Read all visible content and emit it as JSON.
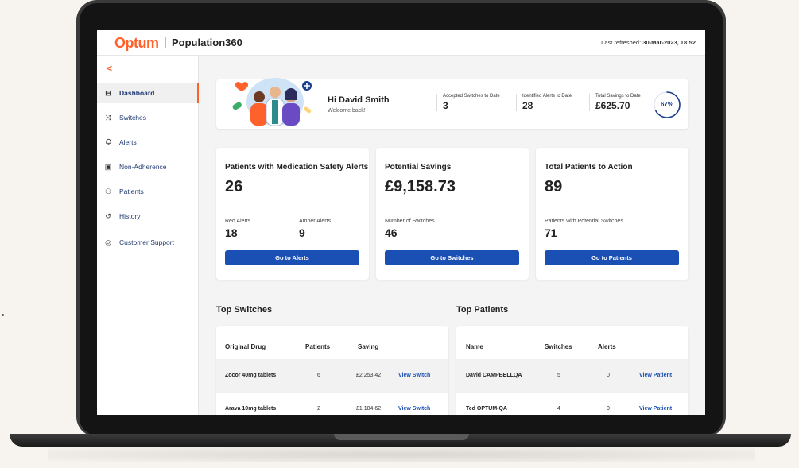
{
  "header": {
    "brand": "Optum",
    "product": "Population360",
    "refresh_label": "Last refreshed: ",
    "refresh_value": "30-Mar-2023, 18:52"
  },
  "sidebar": {
    "back": "<",
    "items": [
      {
        "label": "Dashboard",
        "icon": "dashboard-icon",
        "glyph": "⊟",
        "active": true
      },
      {
        "label": "Switches",
        "icon": "shuffle-icon",
        "glyph": "⤨",
        "active": false
      },
      {
        "label": "Alerts",
        "icon": "bell-icon",
        "glyph": "♫",
        "active": false
      },
      {
        "label": "Non-Adherence",
        "icon": "document-icon",
        "glyph": "▣",
        "active": false
      },
      {
        "label": "Patients",
        "icon": "users-icon",
        "glyph": "⚇",
        "active": false
      },
      {
        "label": "History",
        "icon": "history-icon",
        "glyph": "↺",
        "active": false
      },
      {
        "label": "Customer Support",
        "icon": "chat-icon",
        "glyph": "◎",
        "active": false
      }
    ]
  },
  "welcome": {
    "greeting": "Hi David Smith",
    "sub": "Welcome back!",
    "stats": [
      {
        "label": "Accepted Switches to Date",
        "value": "3"
      },
      {
        "label": "Identified Alerts to Date",
        "value": "28"
      },
      {
        "label": "Total Savings to Date",
        "value": "£625.70"
      }
    ],
    "progress_label": "67%",
    "progress_value": 0.67
  },
  "cards": [
    {
      "title": "Patients with Medication Safety Alerts",
      "big": "26",
      "subs": [
        {
          "label": "Red Alerts",
          "value": "18"
        },
        {
          "label": "Amber Alerts",
          "value": "9"
        }
      ],
      "button": "Go to Alerts"
    },
    {
      "title": "Potential Savings",
      "big": "£9,158.73",
      "subs": [
        {
          "label": "Number of Switches",
          "value": "46"
        }
      ],
      "button": "Go to Switches"
    },
    {
      "title": "Total Patients to Action",
      "big": "89",
      "subs": [
        {
          "label": "Patients with Potential Switches",
          "value": "71"
        }
      ],
      "button": "Go to Patients"
    }
  ],
  "top_switches": {
    "title": "Top Switches",
    "columns": [
      "Original Drug",
      "Patients",
      "Saving"
    ],
    "rows": [
      {
        "drug": "Zocor 40mg tablets",
        "patients": "6",
        "saving": "£2,253.42",
        "action": "View Switch"
      },
      {
        "drug": "Arava 10mg tablets",
        "patients": "2",
        "saving": "£1,184.62",
        "action": "View Switch"
      }
    ]
  },
  "top_patients": {
    "title": "Top Patients",
    "columns": [
      "Name",
      "Switches",
      "Alerts"
    ],
    "rows": [
      {
        "name": "David CAMPBELLQA",
        "switches": "5",
        "alerts": "0",
        "action": "View Patient"
      },
      {
        "name": "Ted OPTUM-QA",
        "switches": "4",
        "alerts": "0",
        "action": "View Patient"
      }
    ]
  },
  "colors": {
    "accent": "#ff612b",
    "primary": "#1a4fb4",
    "ring": "#1a3e8c"
  }
}
